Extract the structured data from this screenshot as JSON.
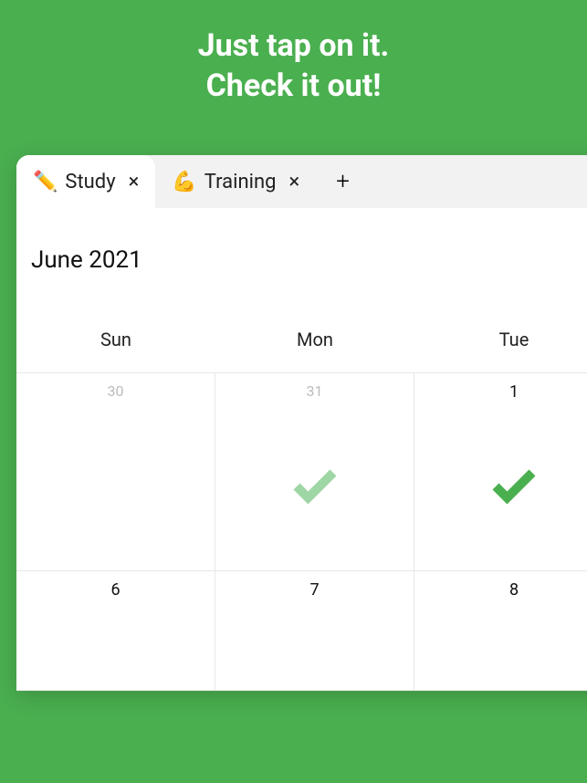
{
  "hero": {
    "line1": "Just tap on it.",
    "line2": "Check it out!"
  },
  "tabs": [
    {
      "emoji": "✏️",
      "label": "Study",
      "active": true
    },
    {
      "emoji": "💪",
      "label": "Training",
      "active": false
    }
  ],
  "month": "June 2021",
  "dow": [
    "Sun",
    "Mon",
    "Tue"
  ],
  "days": {
    "r0c0": "30",
    "r0c1": "31",
    "r0c2": "1",
    "r1c0": "6",
    "r1c1": "7",
    "r1c2": "8"
  }
}
